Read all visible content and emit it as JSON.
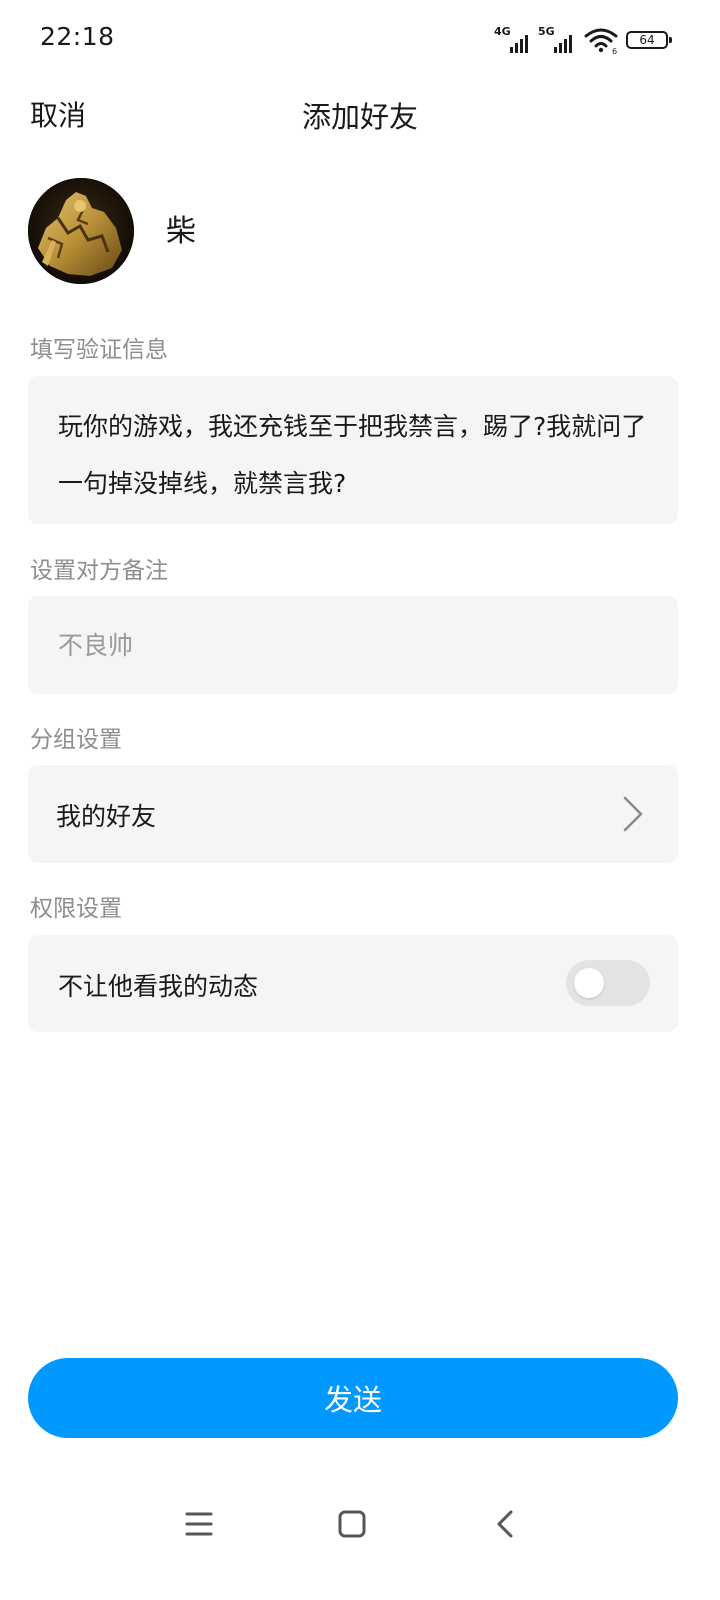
{
  "status_bar": {
    "time": "22:18",
    "network_1": "4G",
    "network_2": "5G",
    "battery": "64",
    "icons": [
      "signal-4g-icon",
      "signal-5g-icon",
      "wifi-icon",
      "battery-icon"
    ]
  },
  "header": {
    "cancel_label": "取消",
    "title": "添加好友"
  },
  "profile": {
    "nickname": "柴"
  },
  "verify": {
    "label": "填写验证信息",
    "message": "玩你的游戏，我还充钱至于把我禁言，踢了?我就问了一句掉没掉线，就禁言我?"
  },
  "remark": {
    "label": "设置对方备注",
    "placeholder": "不良帅",
    "value": ""
  },
  "group": {
    "label": "分组设置",
    "value": "我的好友"
  },
  "permission": {
    "label": "权限设置",
    "option_label": "不让他看我的动态",
    "enabled": false
  },
  "send_label": "发送",
  "colors": {
    "accent": "#0099ff",
    "card_bg": "#f5f5f5",
    "muted_text": "#8e8e8e",
    "toggle_off": "#e3e3e3"
  },
  "nav_bar": {
    "icons": [
      "menu-icon",
      "home-icon",
      "back-icon"
    ]
  }
}
